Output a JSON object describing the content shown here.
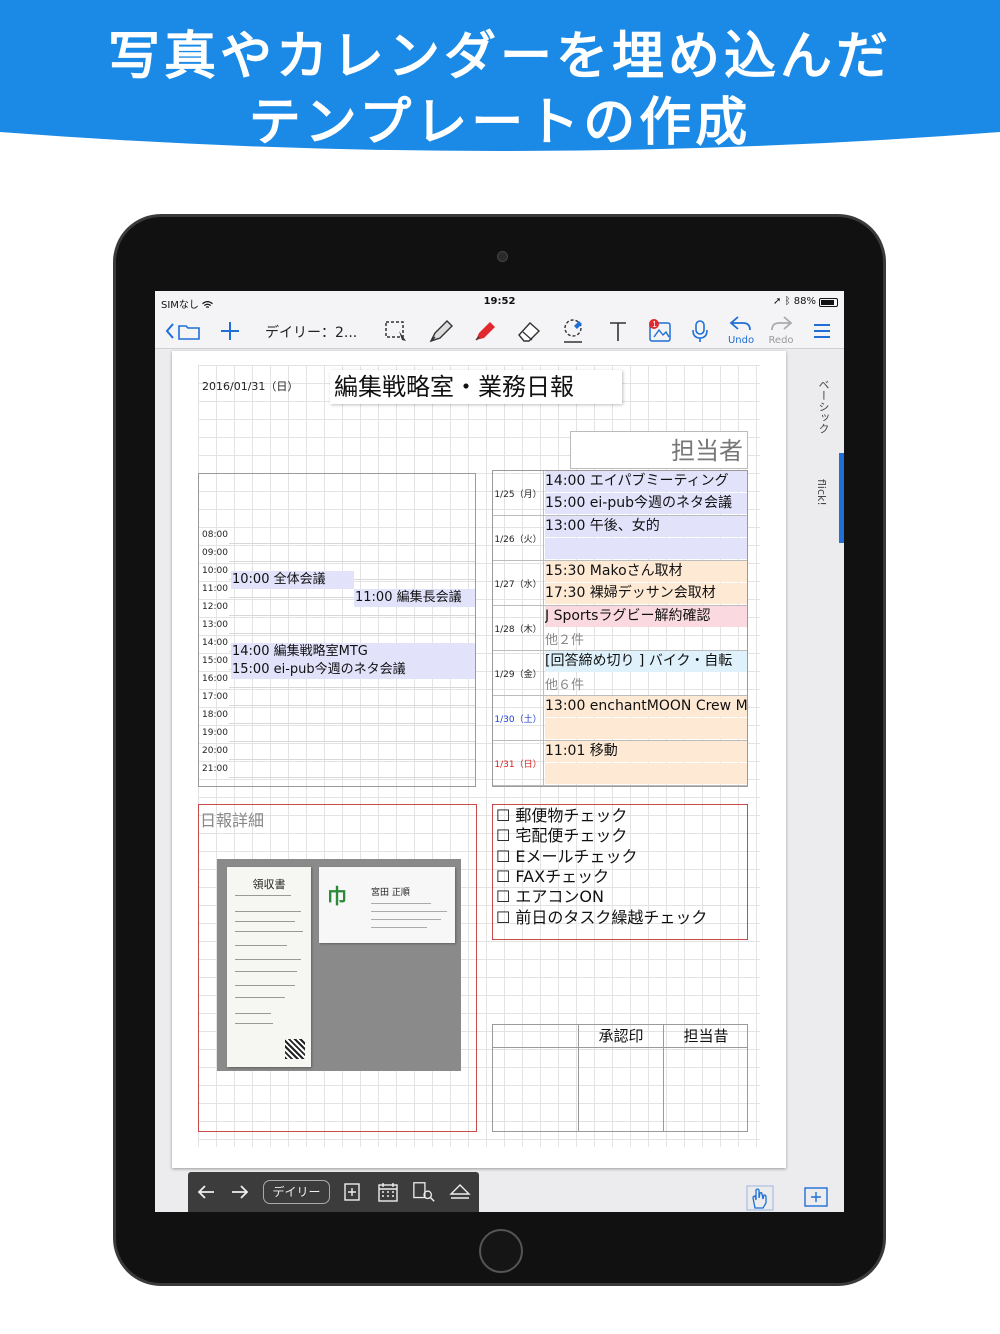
{
  "banner": {
    "line1": "写真やカレンダーを埋め込んだ",
    "line2": "テンプレートの作成",
    "color": "#1a8ae6"
  },
  "status": {
    "carrier": "SIMなし",
    "time": "19:52",
    "battery": "88%",
    "battery_level": 0.88
  },
  "toolbar": {
    "notebook_title": "デイリー：2...",
    "undo_label": "Undo",
    "redo_label": "Redo",
    "accent": "#1f6fd6"
  },
  "page": {
    "date": "2016/01/31（日）",
    "title": "編集戦略室・業務日報",
    "tanto_field": "担当者",
    "timeline": {
      "hours": [
        "08:00",
        "09:00",
        "10:00",
        "11:00",
        "12:00",
        "13:00",
        "14:00",
        "15:00",
        "16:00",
        "17:00",
        "18:00",
        "19:00",
        "20:00",
        "21:00"
      ],
      "events": [
        "10:00 全体会議",
        "11:00 編集長会議",
        "14:00 編集戦略室MTG",
        "15:00 ei-pub今週のネタ会議"
      ]
    },
    "week": [
      {
        "day": "1/25（月）",
        "lines": [
          "14:00 エイパブミーティング",
          "15:00 ei-pub今週のネタ会議"
        ],
        "more": "",
        "color": "#e2e2fb"
      },
      {
        "day": "1/26（火）",
        "lines": [
          "13:00 午後、女的"
        ],
        "more": "",
        "color": "#e2e2fb"
      },
      {
        "day": "1/27（水）",
        "lines": [
          "15:30 Makoさん取材",
          "17:30 裸婦デッサン会取材"
        ],
        "more": "",
        "color": "#fde9d4"
      },
      {
        "day": "1/28（木）",
        "lines": [
          "J Sportsラグビー解約確認"
        ],
        "more": "他２件",
        "color": "#fbd9e0"
      },
      {
        "day": "1/29（金）",
        "lines": [
          "[回答締め切り ] バイク・自転"
        ],
        "more": "他６件",
        "color": "#dff1fb"
      },
      {
        "day": "1/30（土）",
        "lines": [
          "13:00 enchantMOON Crew M"
        ],
        "more": "",
        "color": "#fde9d4"
      },
      {
        "day": "1/31（日）",
        "lines": [
          "11:01 移動"
        ],
        "more": "",
        "color": "#fde9d4"
      }
    ],
    "detail_label": "日報詳細",
    "receipt_title": "領収書",
    "card_name": "宮田 正順",
    "checklist": [
      "☐ 郵便物チェック",
      "☐ 宅配便チェック",
      "☐ Eメールチェック",
      "☐ FAXチェック",
      "☐ エアコンON",
      "☐ 前日のタスク繰越チェック"
    ],
    "approval_headers": [
      "承認印",
      "担当昔"
    ]
  },
  "side_tabs": [
    "ベーシック",
    "flick!"
  ],
  "bottombar": {
    "pill_label": "デイリー"
  }
}
